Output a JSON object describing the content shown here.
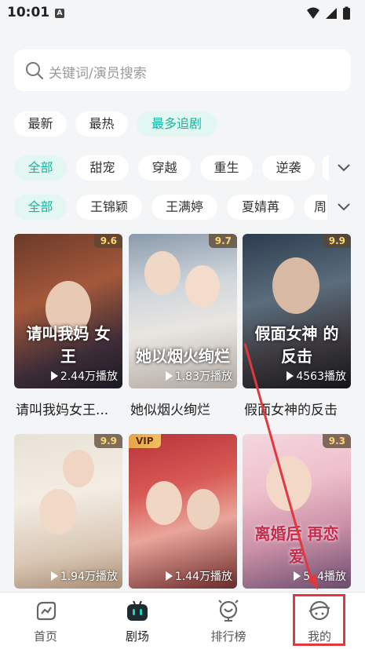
{
  "status": {
    "time": "10:01",
    "notify_icon": "A"
  },
  "search": {
    "placeholder": "关键词/演员搜索"
  },
  "sort_tabs": [
    "最新",
    "最热",
    "最多追剧"
  ],
  "genre_filters": [
    "全部",
    "甜宠",
    "穿越",
    "重生",
    "逆袭"
  ],
  "actor_filters": [
    "全部",
    "王锦颖",
    "王满婷",
    "夏婧苒",
    "周"
  ],
  "dramas": [
    {
      "title": "请叫我妈女王...",
      "rating": "9.6",
      "plays": "2.44万播放",
      "poster_text": "请叫我妈 女王",
      "vip": ""
    },
    {
      "title": "她似烟火绚烂",
      "rating": "9.7",
      "plays": "1.83万播放",
      "poster_text": "她以烟火绚烂",
      "vip": ""
    },
    {
      "title": "假面女神的反击",
      "rating": "9.9",
      "plays": "4563播放",
      "poster_text": "假面女神 的反击",
      "vip": ""
    },
    {
      "title": "",
      "rating": "9.9",
      "plays": "1.94万播放",
      "poster_text": "",
      "vip": ""
    },
    {
      "title": "",
      "rating": "",
      "plays": "1.44万播放",
      "poster_text": "",
      "vip": "VIP"
    },
    {
      "title": "",
      "rating": "9.3",
      "plays": "5.  4播放",
      "poster_text": "离婚后 再恋爱",
      "vip": ""
    }
  ],
  "tabbar": {
    "home": "首页",
    "theater": "剧场",
    "ranking": "排行榜",
    "mine": "我的"
  },
  "colors": {
    "accent": "#14b8a0",
    "highlight": "#e0383e"
  }
}
